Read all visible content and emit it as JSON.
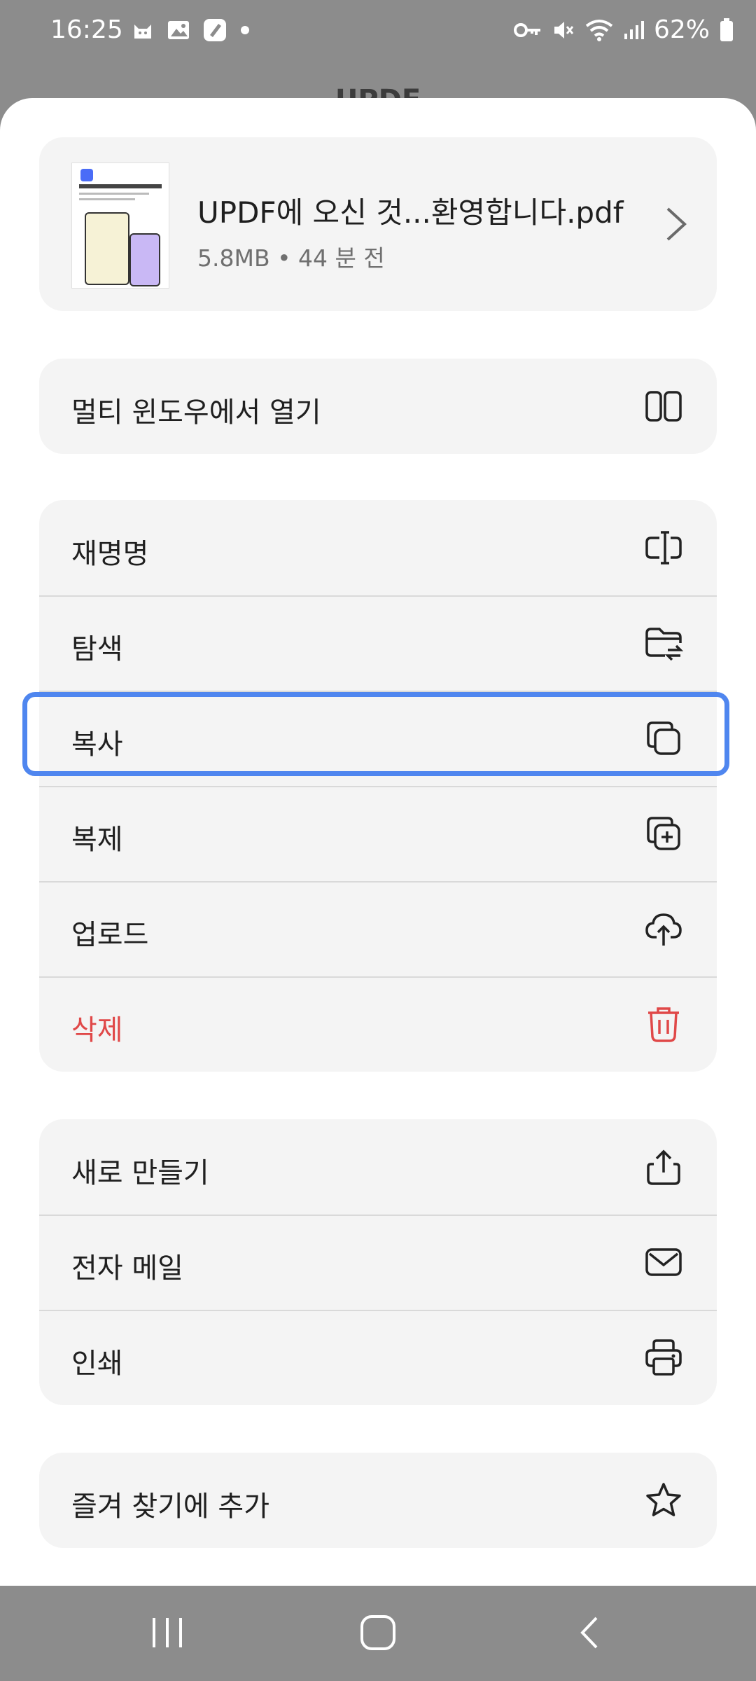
{
  "status_bar": {
    "time": "16:25",
    "battery_percent": "62%",
    "left_icons": [
      "cat-notification-icon",
      "gallery-icon",
      "pen-app-icon",
      "dot-icon"
    ],
    "right_icons": [
      "vpn-key-icon",
      "mute-icon",
      "wifi-icon",
      "signal-icon",
      "battery-icon"
    ]
  },
  "background_app": {
    "title": "UPDF"
  },
  "file": {
    "name": "UPDF에 오신 것...환영합니다.pdf",
    "meta": "5.8MB • 44 분 전"
  },
  "groups": [
    {
      "items": [
        {
          "label": "멀티 윈도우에서 열기",
          "icon": "split-window-icon"
        }
      ]
    },
    {
      "items": [
        {
          "label": "재명명",
          "icon": "rename-cursor-icon"
        },
        {
          "label": "탐색",
          "icon": "folder-swap-icon"
        },
        {
          "label": "복사",
          "icon": "copy-icon"
        },
        {
          "label": "복제",
          "icon": "duplicate-icon"
        },
        {
          "label": "업로드",
          "icon": "cloud-upload-icon"
        },
        {
          "label": "삭제",
          "icon": "trash-icon"
        }
      ]
    },
    {
      "items": [
        {
          "label": "새로 만들기",
          "icon": "share-icon"
        },
        {
          "label": "전자 메일",
          "icon": "mail-icon"
        },
        {
          "label": "인쇄",
          "icon": "printer-icon"
        }
      ]
    },
    {
      "items": [
        {
          "label": "즐겨 찾기에 추가",
          "icon": "star-icon"
        }
      ]
    }
  ],
  "highlighted_item": "복사",
  "colors": {
    "accent": "#4f86ef",
    "danger": "#e04848",
    "card": "#f4f4f4"
  },
  "nav_bar": {
    "buttons": [
      "recents-icon",
      "home-icon",
      "back-icon"
    ]
  }
}
